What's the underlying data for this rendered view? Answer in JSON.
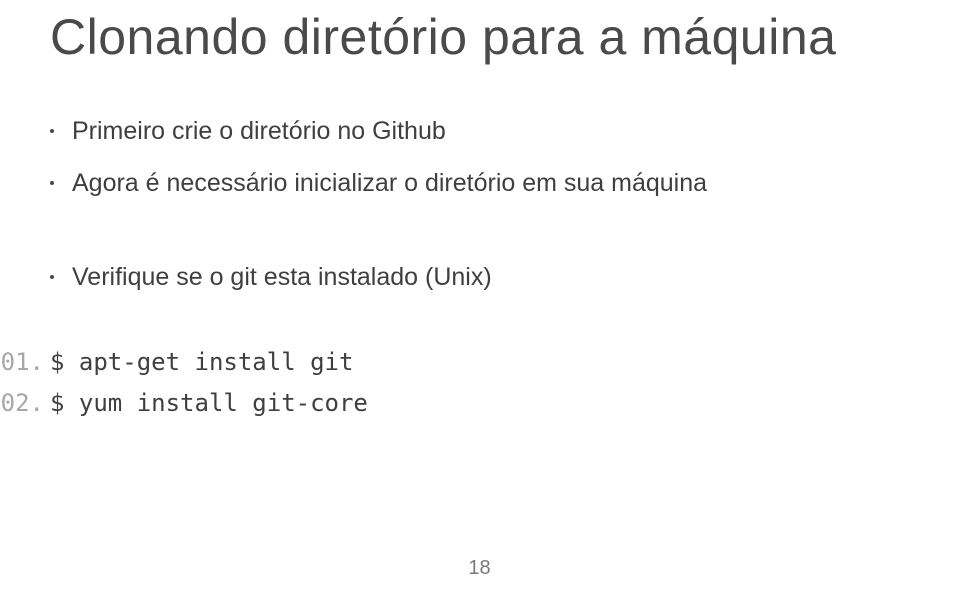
{
  "title": "Clonando diretório para a máquina",
  "bullets_group1": [
    "Primeiro crie o diretório no Github",
    "Agora é necessário inicializar o diretório em sua máquina"
  ],
  "bullets_group2": [
    "Verifique se o git esta instalado (Unix)"
  ],
  "code": {
    "lines": [
      {
        "num": "01.",
        "text": "$ apt-get install git"
      },
      {
        "num": "02.",
        "text": "$ yum install git-core"
      }
    ]
  },
  "page_number": "18"
}
